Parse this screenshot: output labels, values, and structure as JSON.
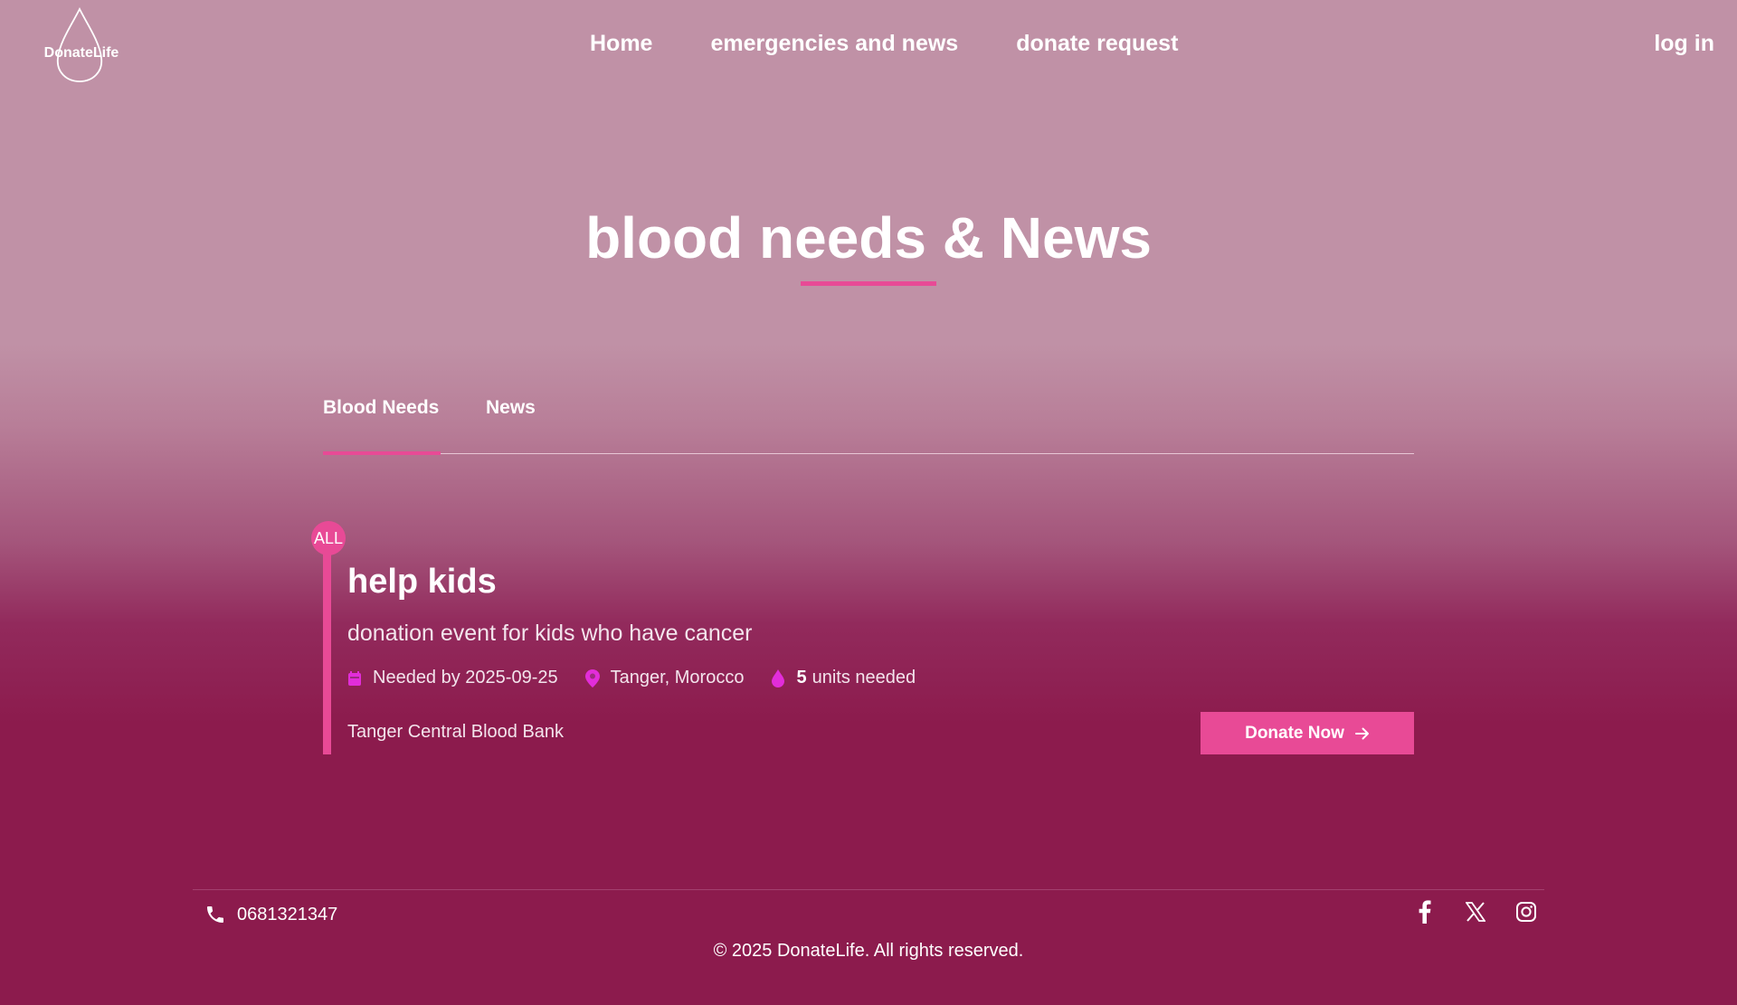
{
  "brand": {
    "name": "DonateLife"
  },
  "nav": {
    "home": "Home",
    "emergencies": "emergencies and news",
    "donate_request": "donate request",
    "login": "log in"
  },
  "page": {
    "title": "blood needs & News"
  },
  "tabs": [
    {
      "label": "Blood Needs",
      "active": true
    },
    {
      "label": "News",
      "active": false
    }
  ],
  "request": {
    "badge": "ALL",
    "title": "help kids",
    "description": "donation event for kids who have cancer",
    "needed_by": "Needed by 2025-09-25",
    "location": "Tanger, Morocco",
    "units_count": "5",
    "units_label": "units needed",
    "bank": "Tanger Central Blood Bank",
    "donate_label": "Donate Now"
  },
  "footer": {
    "phone": "0681321347",
    "copyright": "© 2025 DonateLife. All rights reserved."
  },
  "icons": [
    "drop-logo-icon",
    "calendar-icon",
    "location-pin-icon",
    "blood-drop-icon",
    "arrow-right-icon",
    "phone-icon",
    "facebook-icon",
    "x-icon",
    "instagram-icon"
  ],
  "colors": {
    "accent": "#e84a96",
    "icon_magenta": "#e22dd9",
    "bg_top": "#c091a6",
    "bg_bottom": "#8c1b4d"
  }
}
